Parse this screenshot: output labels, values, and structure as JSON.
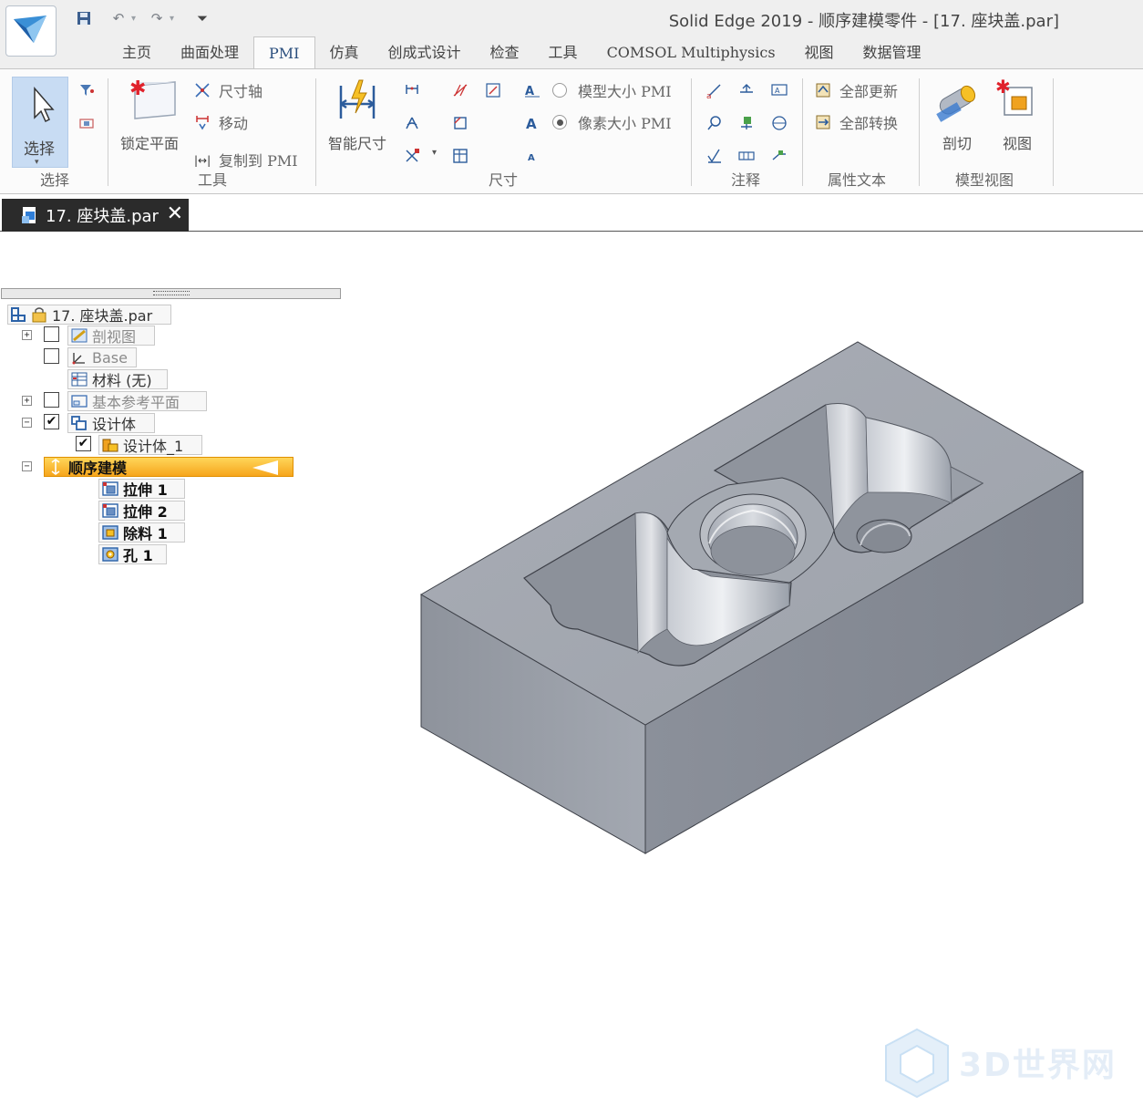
{
  "window": {
    "title": "Solid Edge 2019 - 顺序建模零件 - [17. 座块盖.par]"
  },
  "tabs": [
    {
      "label": "主页"
    },
    {
      "label": "曲面处理"
    },
    {
      "label": "PMI",
      "active": true
    },
    {
      "label": "仿真"
    },
    {
      "label": "创成式设计"
    },
    {
      "label": "检查"
    },
    {
      "label": "工具"
    },
    {
      "label": "COMSOL Multiphysics"
    },
    {
      "label": "视图"
    },
    {
      "label": "数据管理"
    }
  ],
  "ribbon": {
    "select": {
      "label": "选择",
      "group": "选择"
    },
    "tools": {
      "group": "工具",
      "lock_plane": "锁定平面",
      "dimension_axis": "尺寸轴",
      "move": "移动",
      "copy_to_pmi": "复制到 PMI"
    },
    "dimension": {
      "group": "尺寸",
      "smart_dimension": "智能尺寸"
    },
    "pmi_size": {
      "model_size": "模型大小 PMI",
      "pixel_size": "像素大小 PMI",
      "selected": "pixel_size"
    },
    "annotation": {
      "group": "注释"
    },
    "property_text": {
      "group": "属性文本",
      "update_all": "全部更新",
      "convert_all": "全部转换"
    },
    "model_view": {
      "group": "模型视图",
      "section": "剖切",
      "view": "视图"
    }
  },
  "document_tab": {
    "name": "17. 座块盖.par"
  },
  "pathfinder": {
    "root": "17. 座块盖.par",
    "items": [
      {
        "label": "剖视图",
        "expander": "+",
        "checked": false
      },
      {
        "label": "Base",
        "checked": false
      },
      {
        "label": "材料 (无)"
      },
      {
        "label": "基本参考平面",
        "expander": "+",
        "checked": false
      },
      {
        "label": "设计体",
        "expander": "−",
        "checked": true
      },
      {
        "label": "设计体_1",
        "checked": true
      },
      {
        "label": "顺序建模",
        "expander": "−"
      },
      {
        "label": "拉伸 1"
      },
      {
        "label": "拉伸 2"
      },
      {
        "label": "除料 1"
      },
      {
        "label": "孔 1"
      }
    ]
  },
  "watermark": {
    "text": "3D世界网"
  },
  "colors": {
    "accent": "#2b4f7e",
    "sequential_highlight": "#f6a51c",
    "model_gray": "#9ea3ad"
  }
}
